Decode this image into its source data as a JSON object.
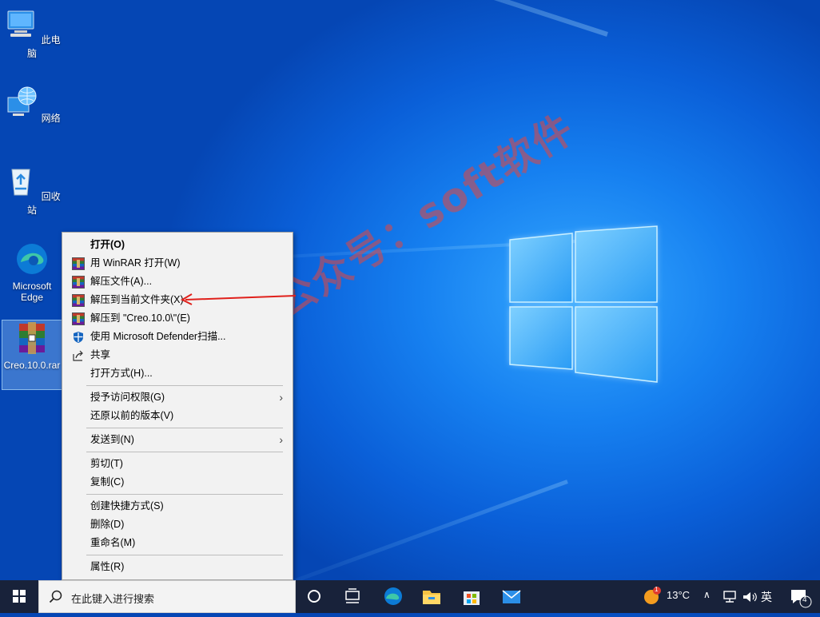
{
  "desktop": {
    "icons": [
      {
        "label": "此电脑"
      },
      {
        "label": "网络"
      },
      {
        "label": "回收站"
      },
      {
        "label": "Microsoft Edge"
      },
      {
        "label": "Creo.10.0.rar"
      }
    ],
    "watermark": "微信公众号：soft软件"
  },
  "context_menu": {
    "items": [
      {
        "label": "打开(O)",
        "bold": true
      },
      {
        "label": "用 WinRAR 打开(W)",
        "icon": "winrar-icon"
      },
      {
        "label": "解压文件(A)...",
        "icon": "winrar-icon"
      },
      {
        "label": "解压到当前文件夹(X)",
        "icon": "winrar-icon",
        "highlighted_by_arrow": true
      },
      {
        "label": "解压到 \"Creo.10.0\\\"(E)",
        "icon": "winrar-icon"
      },
      {
        "label": "使用 Microsoft Defender扫描...",
        "icon": "defender-shield-icon"
      },
      {
        "label": "共享",
        "icon": "share-icon"
      },
      {
        "label": "打开方式(H)..."
      },
      {
        "label": "授予访问权限(G)",
        "submenu": true
      },
      {
        "label": "还原以前的版本(V)"
      },
      {
        "label": "发送到(N)",
        "submenu": true
      },
      {
        "label": "剪切(T)"
      },
      {
        "label": "复制(C)"
      },
      {
        "label": "创建快捷方式(S)"
      },
      {
        "label": "删除(D)"
      },
      {
        "label": "重命名(M)"
      },
      {
        "label": "属性(R)"
      }
    ]
  },
  "annotation": {
    "color": "#e0201b",
    "points_to": "解压到当前文件夹(X)"
  },
  "taskbar": {
    "search_placeholder": "在此键入进行搜索",
    "weather_temp": "13°C",
    "weather_badge": "1",
    "input_method": "英",
    "notification_count": "4",
    "pinned": [
      "task-view-icon",
      "edge-icon",
      "file-explorer-icon",
      "store-icon",
      "mail-icon"
    ]
  },
  "colors": {
    "accent": "#0a6ad8",
    "taskbar": "#18223a",
    "menu_bg": "#f2f2f2"
  }
}
